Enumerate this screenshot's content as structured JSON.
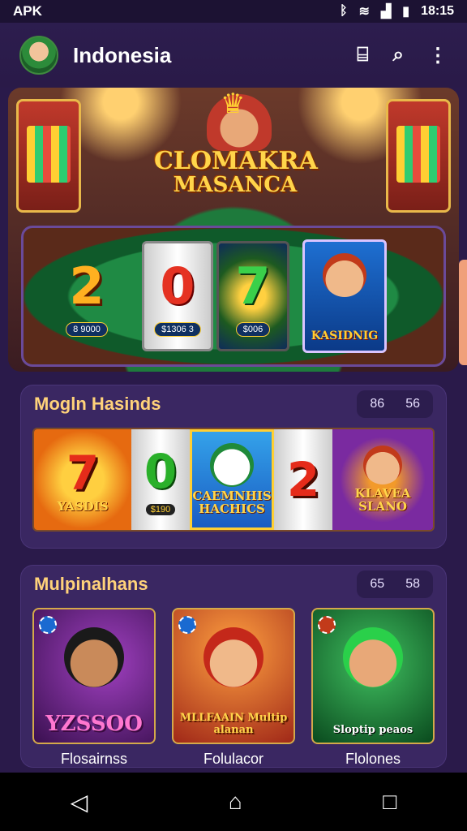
{
  "status_bar": {
    "left_text": "APK",
    "time": "18:15",
    "icons": [
      "bluetooth-icon",
      "wifi-icon",
      "signal-icon",
      "battery-icon"
    ]
  },
  "header": {
    "title": "Indonesia",
    "actions": [
      "bookmark-icon",
      "search-icon",
      "more-icon"
    ]
  },
  "hero": {
    "logo_line1": "CLOMAKRA",
    "logo_line2": "MASANCA",
    "reels": [
      {
        "digit": "2",
        "pill": "8 9000"
      },
      {
        "digit": "0",
        "pill": "$1306 3"
      },
      {
        "digit": "7",
        "pill": "$006"
      }
    ],
    "feature_card_text": "KASIDNIG"
  },
  "section1": {
    "title": "Mogln Hasinds",
    "count_a": "86",
    "count_b": "56",
    "tiles": [
      {
        "big": "7",
        "caption": "YASDIS"
      },
      {
        "big": "0",
        "pill": "$190"
      },
      {
        "caption": "CAEMNHIS HACHICS"
      },
      {
        "big": "2"
      },
      {
        "caption": "KLAVEA SLANO"
      }
    ]
  },
  "section2": {
    "title": "Mulpinalhans",
    "count_a": "65",
    "count_b": "58",
    "cards": [
      {
        "banner": "YZSSOO",
        "label": "Flosairnss"
      },
      {
        "banner": "MLLFAAIN Multip alanan",
        "label": "Folulacor"
      },
      {
        "banner": "Sloptip peaos",
        "label": "Flolones"
      }
    ]
  },
  "nav": {
    "back": "◁",
    "home": "⌂",
    "recents": "□"
  },
  "colors": {
    "background": "#2a1a4a",
    "section_bg": "#3a2762",
    "title_gold": "#ffd27a"
  }
}
